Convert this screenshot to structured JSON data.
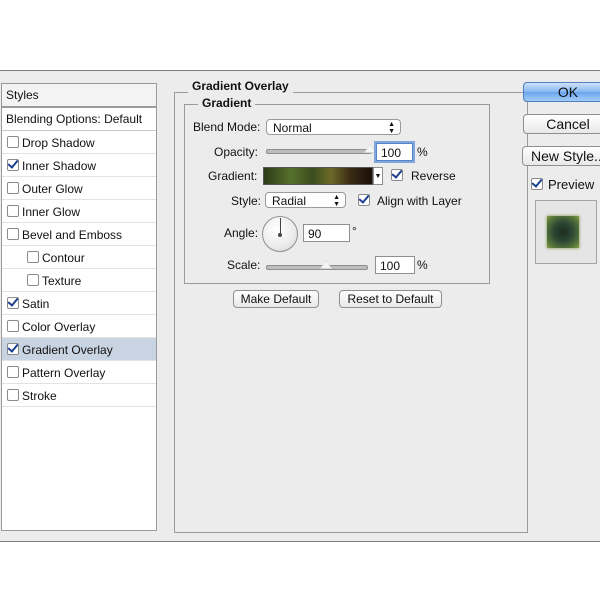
{
  "styles_panel": {
    "header": "Styles",
    "blending_options": "Blending Options: Default",
    "items": [
      {
        "label": "Drop Shadow",
        "checked": false,
        "sub": false,
        "selected": false
      },
      {
        "label": "Inner Shadow",
        "checked": true,
        "sub": false,
        "selected": false
      },
      {
        "label": "Outer Glow",
        "checked": false,
        "sub": false,
        "selected": false
      },
      {
        "label": "Inner Glow",
        "checked": false,
        "sub": false,
        "selected": false
      },
      {
        "label": "Bevel and Emboss",
        "checked": false,
        "sub": false,
        "selected": false
      },
      {
        "label": "Contour",
        "checked": false,
        "sub": true,
        "selected": false
      },
      {
        "label": "Texture",
        "checked": false,
        "sub": true,
        "selected": false
      },
      {
        "label": "Satin",
        "checked": true,
        "sub": false,
        "selected": false
      },
      {
        "label": "Color Overlay",
        "checked": false,
        "sub": false,
        "selected": false
      },
      {
        "label": "Gradient Overlay",
        "checked": true,
        "sub": false,
        "selected": true
      },
      {
        "label": "Pattern Overlay",
        "checked": false,
        "sub": false,
        "selected": false
      },
      {
        "label": "Stroke",
        "checked": false,
        "sub": false,
        "selected": false
      }
    ]
  },
  "gradient_overlay": {
    "section_title": "Gradient Overlay",
    "group_title": "Gradient",
    "blend_mode_label": "Blend Mode:",
    "blend_mode_value": "Normal",
    "opacity_label": "Opacity:",
    "opacity_value": "100",
    "opacity_unit": "%",
    "opacity_fraction": 1.0,
    "gradient_label": "Gradient:",
    "reverse_label": "Reverse",
    "reverse_checked": true,
    "style_label": "Style:",
    "style_value": "Radial",
    "align_label": "Align with Layer",
    "align_checked": true,
    "angle_label": "Angle:",
    "angle_value": "90",
    "angle_unit": "°",
    "scale_label": "Scale:",
    "scale_value": "100",
    "scale_unit": "%",
    "scale_fraction": 0.5,
    "make_default": "Make Default",
    "reset_default": "Reset to Default"
  },
  "right_panel": {
    "ok": "OK",
    "cancel": "Cancel",
    "new_style": "New Style...",
    "preview_label": "Preview",
    "preview_checked": true
  }
}
